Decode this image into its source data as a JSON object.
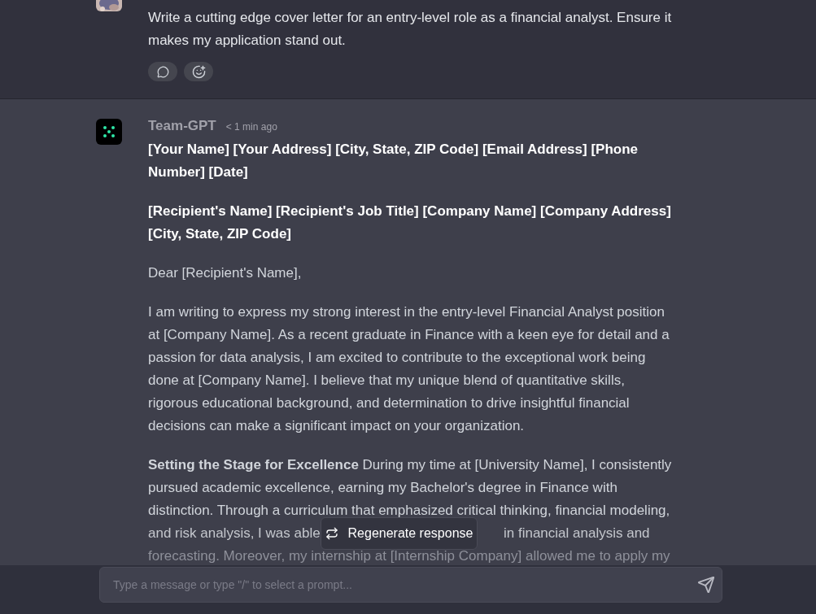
{
  "user_message": {
    "text": "Write a cutting edge cover letter for an entry-level role as a financial analyst. Ensure it makes my application stand out."
  },
  "assistant_message": {
    "name": "Team-GPT",
    "time": "< 1 min ago",
    "paragraphs": [
      {
        "kind": "heading",
        "text": "[Your Name] [Your Address] [City, State, ZIP Code] [Email Address] [Phone Number] [Date]"
      },
      {
        "kind": "heading",
        "text": "[Recipient's Name] [Recipient's Job Title] [Company Name] [Company Address] [City, State, ZIP Code]"
      },
      {
        "kind": "plain",
        "text": "Dear [Recipient's Name],"
      },
      {
        "kind": "plain",
        "text": "I am writing to express my strong interest in the entry-level Financial Analyst position at [Company Name]. As a recent graduate in Finance with a keen eye for detail and a passion for data analysis, I am excited to contribute to the exceptional work being done at [Company Name]. I believe that my unique blend of quantitative skills, rigorous educational background, and determination to drive insightful financial decisions can make a significant impact on your organization."
      },
      {
        "kind": "covered",
        "lines": [
          "**Setting the Stage for Excellence** During my time at [University Name], I consistently",
          "pursued academic excellence, earning my Bachelor's degree in Finance with",
          "distinction. Through a curriculum that emphasized critical thinking, financial modeling,"
        ],
        "text_before_cover": "and risk analysis, I was able",
        "text_after_cover": "in financial analysis and",
        "text_last": "forecasting. Moreover, my internship at [Internship Company] allowed me to apply my"
      }
    ]
  },
  "regenerate_button": {
    "label": "Regenerate response"
  },
  "composer": {
    "placeholder": "Type a message or type \"/\" to select a prompt..."
  }
}
